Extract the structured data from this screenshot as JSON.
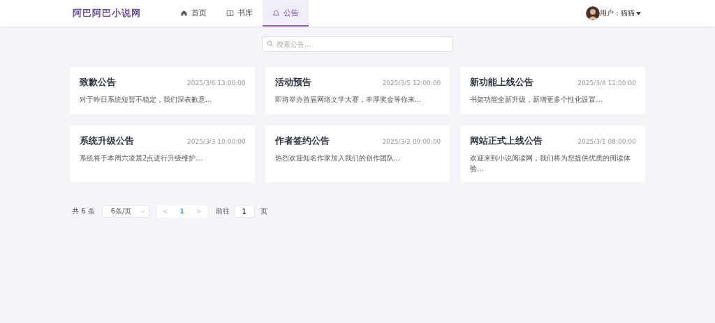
{
  "header": {
    "logo": "阿巴阿巴小说网",
    "nav": [
      {
        "label": "首页",
        "selected": false
      },
      {
        "label": "书库",
        "selected": false
      },
      {
        "label": "公告",
        "selected": true
      }
    ],
    "user": {
      "label": "用户：猫猫"
    }
  },
  "search": {
    "placeholder": "搜索公告..."
  },
  "notices": [
    {
      "title": "致歉公告",
      "date": "2025/3/6 13:00:00",
      "summary": "对于昨日系统短暂不稳定，我们深表歉意..."
    },
    {
      "title": "活动预告",
      "date": "2025/3/5 12:00:00",
      "summary": "即将举办首届网络文学大赛，丰厚奖金等你来..."
    },
    {
      "title": "新功能上线公告",
      "date": "2025/3/4 11:00:00",
      "summary": "书架功能全新升级，新增更多个性化设置..."
    },
    {
      "title": "系统升级公告",
      "date": "2025/3/3 10:00:00",
      "summary": "系统将于本周六凌晨2点进行升级维护..."
    },
    {
      "title": "作者签约公告",
      "date": "2025/3/2 09:00:00",
      "summary": "热烈欢迎知名作家加入我们的创作团队..."
    },
    {
      "title": "网站正式上线公告",
      "date": "2025/3/1 08:00:00",
      "summary": "欢迎来到小说阅读网，我们将为您提供优质的阅读体验..."
    }
  ],
  "pagination": {
    "total": "共 6 条",
    "page_size": "6条/页",
    "prev": "<",
    "pages": [
      {
        "label": "1",
        "selected": true
      }
    ],
    "next": ">",
    "goto_label": "前往",
    "goto_value": "1",
    "goto_suffix": "页"
  }
}
